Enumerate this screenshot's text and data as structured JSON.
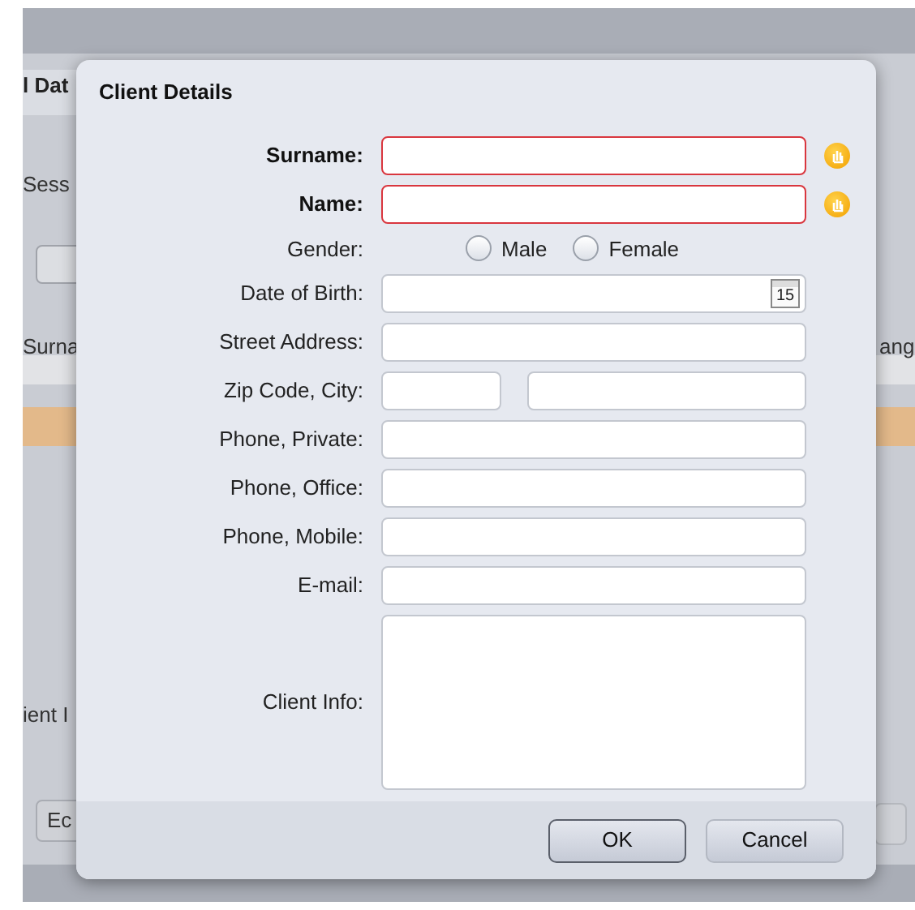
{
  "background_window": {
    "title": "l Dat",
    "session_label": "Sess",
    "column_1": "Surna",
    "column_2": "ang",
    "section_label": "ient I",
    "button": "Ec"
  },
  "dialog": {
    "title": "Client Details",
    "fields": [
      {
        "kind": "text",
        "label": "Surname:",
        "required": true
      },
      {
        "kind": "text",
        "label": "Name:",
        "required": true
      },
      {
        "kind": "radio",
        "label": "Gender:",
        "options": [
          {
            "label": "Male",
            "selected": false
          },
          {
            "label": "Female",
            "selected": false
          }
        ]
      },
      {
        "kind": "date",
        "label": "Date of Birth:",
        "required": false,
        "calendar_day": "15"
      },
      {
        "kind": "text",
        "label": "Street Address:",
        "required": false
      },
      {
        "kind": "zip_city",
        "label": "Zip Code, City:",
        "required": false
      },
      {
        "kind": "text",
        "label": "Phone, Private:",
        "required": false
      },
      {
        "kind": "text",
        "label": "Phone, Office:",
        "required": false
      },
      {
        "kind": "text",
        "label": "Phone, Mobile:",
        "required": false
      },
      {
        "kind": "text",
        "label": "E-mail:",
        "required": false
      },
      {
        "kind": "textarea",
        "label": "Client Info:",
        "required": false
      }
    ],
    "buttons": [
      {
        "label": "OK",
        "default": true
      },
      {
        "label": "Cancel",
        "default": false
      }
    ]
  }
}
